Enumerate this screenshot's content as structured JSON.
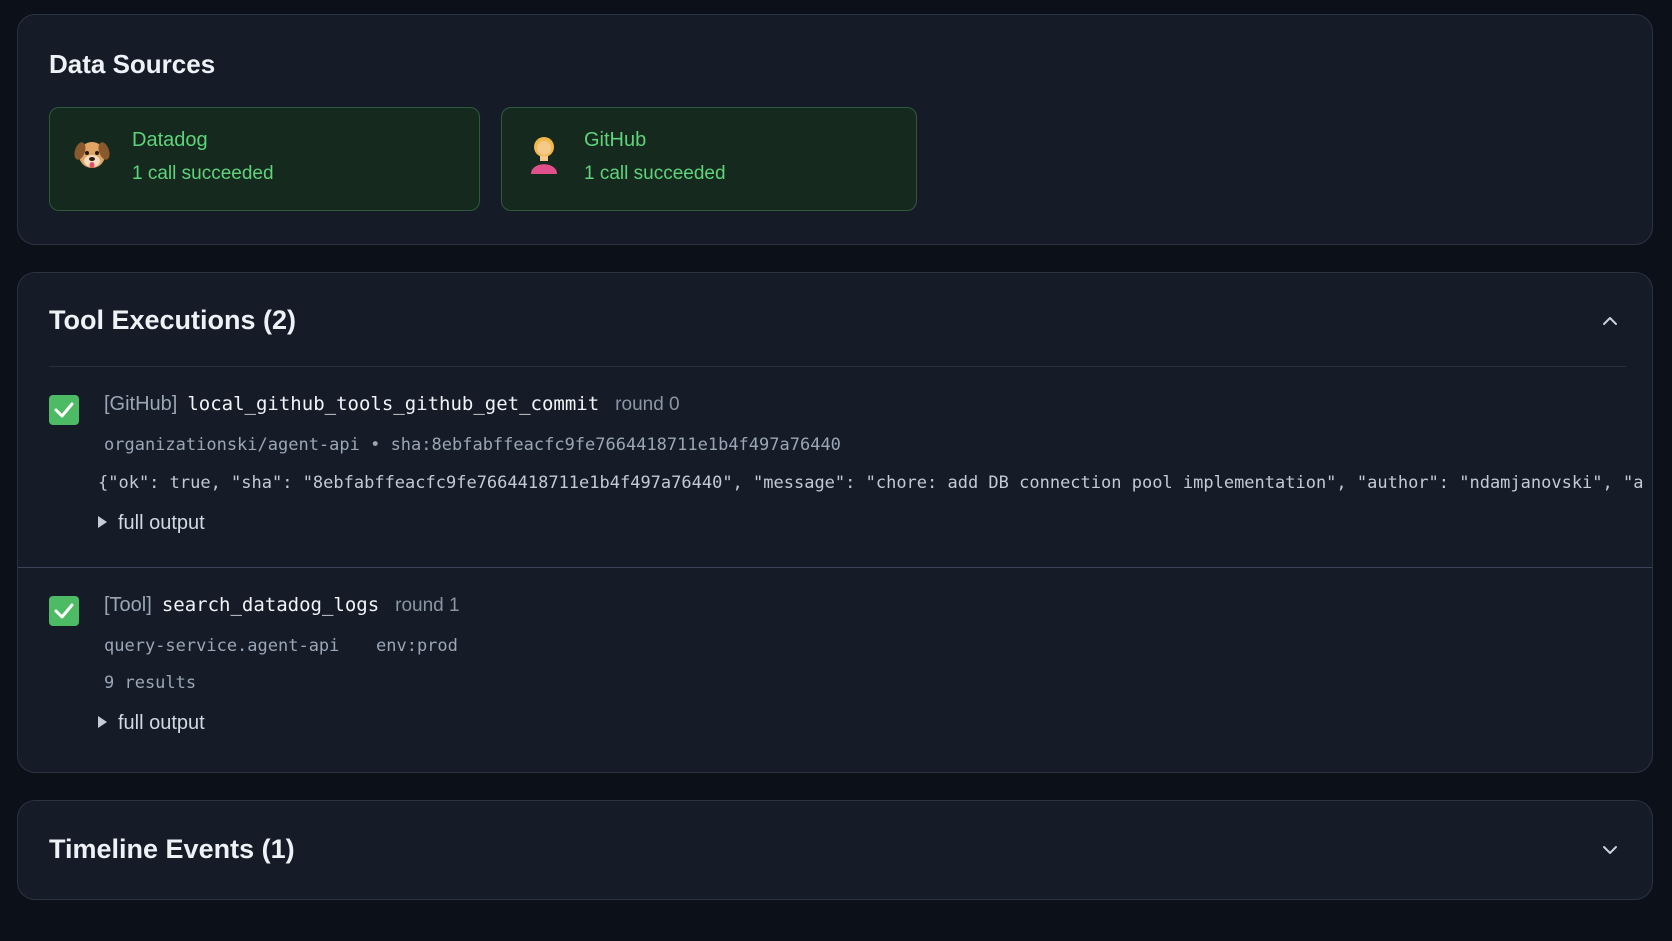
{
  "data_sources": {
    "title": "Data Sources",
    "items": [
      {
        "name": "Datadog",
        "status": "1 call succeeded",
        "icon": "dog-face-icon"
      },
      {
        "name": "GitHub",
        "status": "1 call succeeded",
        "icon": "person-icon"
      }
    ]
  },
  "tool_executions": {
    "title": "Tool Executions (2)",
    "collapse_icon": "chevron-up-icon",
    "items": [
      {
        "source": "[GitHub]",
        "tool": "local_github_tools_github_get_commit",
        "round": "round 0",
        "meta": "organizationski/agent-api • sha:8ebfabffeacfc9fe7664418711e1b4f497a76440",
        "output_preview": "{\"ok\": true, \"sha\": \"8ebfabffeacfc9fe7664418711e1b4f497a76440\", \"message\": \"chore: add DB connection pool implementation\", \"author\": \"ndamjanovski\", \"author_ema",
        "full_output_label": "full output",
        "status": "success"
      },
      {
        "source": "[Tool]",
        "tool": "search_datadog_logs",
        "round": "round 1",
        "meta_service": "query-service.agent-api",
        "meta_env": "env:prod",
        "results": "9 results",
        "full_output_label": "full output",
        "status": "success"
      }
    ]
  },
  "timeline": {
    "title": "Timeline Events (1)",
    "expand_icon": "chevron-down-icon"
  },
  "colors": {
    "background": "#0c1119",
    "card": "#151c27",
    "success_green": "#4cbb63",
    "source_text_green": "#5fd37a"
  }
}
